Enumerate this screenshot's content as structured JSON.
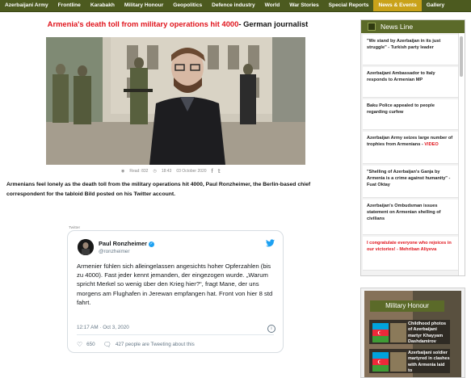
{
  "nav": {
    "items": [
      {
        "label": "Azerbaijani Army",
        "active": false
      },
      {
        "label": "Frontline",
        "active": false
      },
      {
        "label": "Karabakh",
        "active": false
      },
      {
        "label": "Military Honour",
        "active": false
      },
      {
        "label": "Geopolitics",
        "active": false
      },
      {
        "label": "Defence industry",
        "active": false
      },
      {
        "label": "World",
        "active": false
      },
      {
        "label": "War Stories",
        "active": false
      },
      {
        "label": "Special Reports",
        "active": false
      },
      {
        "label": "News & Events",
        "active": true
      },
      {
        "label": "Gallery",
        "active": false
      }
    ]
  },
  "article": {
    "headline_red": "Armenia's death toll from military operations hit 4000",
    "headline_black": "- German journalist",
    "meta_reads": "Read: 832",
    "meta_time": "18:43",
    "meta_date": "03 October 2020",
    "lead": "Armenians feel lonely as the death toll from the military operations hit 4000, Paul Ronzheimer, the Berlin-based chief correspondent for the tabloid Bild posted on his Twitter account.",
    "embed_label": "Twitter"
  },
  "tweet": {
    "name": "Paul Ronzheimer",
    "handle": "@ronzheimer",
    "text": "Armenier fühlen sich alleingelassen angesichts hoher Opferzahlen (bis zu 4000). Fast jeder kennt jemanden, der eingezogen wurde. „Warum spricht Merkel so wenig über den Krieg hier?“,  fragt Mane, der uns morgens am Flughafen in Jerewan empfangen hat. Front von hier 8 std fahrt.",
    "timestamp": "12:17 AM · Oct 3, 2020",
    "likes": "650",
    "tweeting": "427 people are Tweeting about this"
  },
  "sidebar": {
    "news_title": "News Line",
    "news": [
      {
        "text": "\"We stand by Azerbaijan in its just struggle\" - Turkish party leader",
        "highlight": ""
      },
      {
        "text": "Azerbaijani Ambassador to Italy responds to Armenian MP",
        "highlight": ""
      },
      {
        "text": "Baku Police appealed to people regarding curfew",
        "highlight": ""
      },
      {
        "text": "Azerbaijan Army seizes large number of trophies from Armenians - ",
        "highlight": "VIDEO"
      },
      {
        "text": "\"Shelling of Azerbaijan's Ganja by Armenia is a crime against humanity\" - Fuat Oktay",
        "highlight": ""
      },
      {
        "text": "Azerbaijan's Ombudsman issues statement on Armenian shelling of civilians",
        "highlight": ""
      },
      {
        "text": "I congratulate everyone who rejoices in our victories! - Mehriban Aliyeva",
        "highlight": "",
        "red": true
      }
    ],
    "honour_title": "Military Honour",
    "honour": [
      "Childhood photos of Azerbaijani martyr Khayyam Dashdamirov",
      "Azerbaijani soldier martyred in clashes with Armenia laid to"
    ]
  },
  "colors": {
    "nav_bg": "#4c5a1f",
    "nav_active": "#c9a21a",
    "headline_red": "#e0141c",
    "twitter_blue": "#1da1f2"
  }
}
